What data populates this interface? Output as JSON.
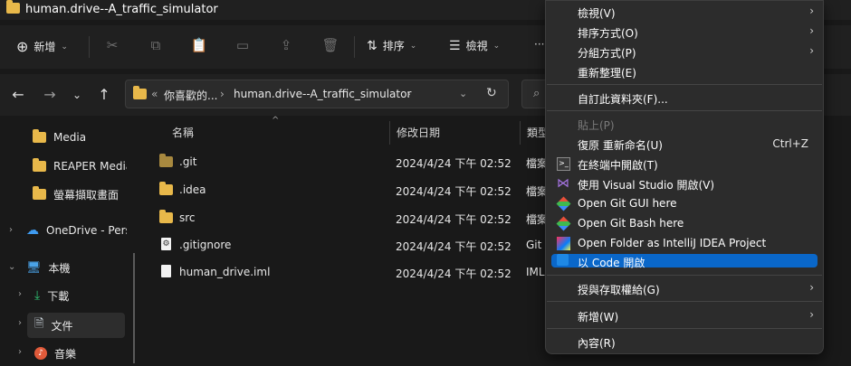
{
  "window": {
    "title": "human.drive--A_traffic_simulator"
  },
  "commandbar": {
    "new_label": "新增",
    "sort_label": "排序",
    "view_label": "檢視",
    "more_label": "···"
  },
  "address": {
    "overflow": "«",
    "crumbs": [
      "你喜歡的...",
      "human.drive--A_traffic_simulator"
    ],
    "separator": "›"
  },
  "sidebar": {
    "items": [
      {
        "label": "Media"
      },
      {
        "label": "REAPER Media"
      },
      {
        "label": "螢幕擷取畫面"
      },
      {
        "label": "OneDrive - Personal"
      },
      {
        "label": "本機"
      },
      {
        "label": "下載"
      },
      {
        "label": "文件"
      },
      {
        "label": "音樂"
      }
    ]
  },
  "filelist": {
    "columns": {
      "name": "名稱",
      "date": "修改日期",
      "type": "類型"
    },
    "rows": [
      {
        "name": ".git",
        "date": "2024/4/24 下午 02:52",
        "type": "檔案"
      },
      {
        "name": ".idea",
        "date": "2024/4/24 下午 02:52",
        "type": "檔案"
      },
      {
        "name": "src",
        "date": "2024/4/24 下午 02:52",
        "type": "檔案"
      },
      {
        "name": ".gitignore",
        "date": "2024/4/24 下午 02:52",
        "type": "Git I"
      },
      {
        "name": "human_drive.iml",
        "date": "2024/4/24 下午 02:52",
        "type": "IML"
      }
    ]
  },
  "menu": {
    "items": [
      {
        "label": "檢視(V)",
        "submenu": true
      },
      {
        "label": "排序方式(O)",
        "submenu": true
      },
      {
        "label": "分組方式(P)",
        "submenu": true
      },
      {
        "label": "重新整理(E)"
      },
      {
        "label": "自訂此資料夾(F)..."
      },
      {
        "label": "貼上(P)",
        "disabled": true
      },
      {
        "label": "復原 重新命名(U)",
        "shortcut": "Ctrl+Z"
      },
      {
        "label": "在終端中開啟(T)",
        "icon": "terminal-icon"
      },
      {
        "label": "使用 Visual Studio 開啟(V)",
        "icon": "visual-studio-icon"
      },
      {
        "label": "Open Git GUI here",
        "icon": "git-gui-icon"
      },
      {
        "label": "Open Git Bash here",
        "icon": "git-bash-icon"
      },
      {
        "label": "Open Folder as IntelliJ IDEA Project",
        "icon": "intellij-icon"
      },
      {
        "label": "以 Code 開啟",
        "icon": "vscode-icon",
        "highlighted": true
      },
      {
        "label": "授與存取權給(G)",
        "submenu": true
      },
      {
        "label": "新增(W)",
        "submenu": true
      },
      {
        "label": "內容(R)"
      }
    ],
    "submenu_arrow": "›"
  },
  "colors": {
    "background": "#191919",
    "chrome": "#202020",
    "menu": "#2c2c2c",
    "highlight": "#0a67c9",
    "folder": "#e8b84a"
  }
}
